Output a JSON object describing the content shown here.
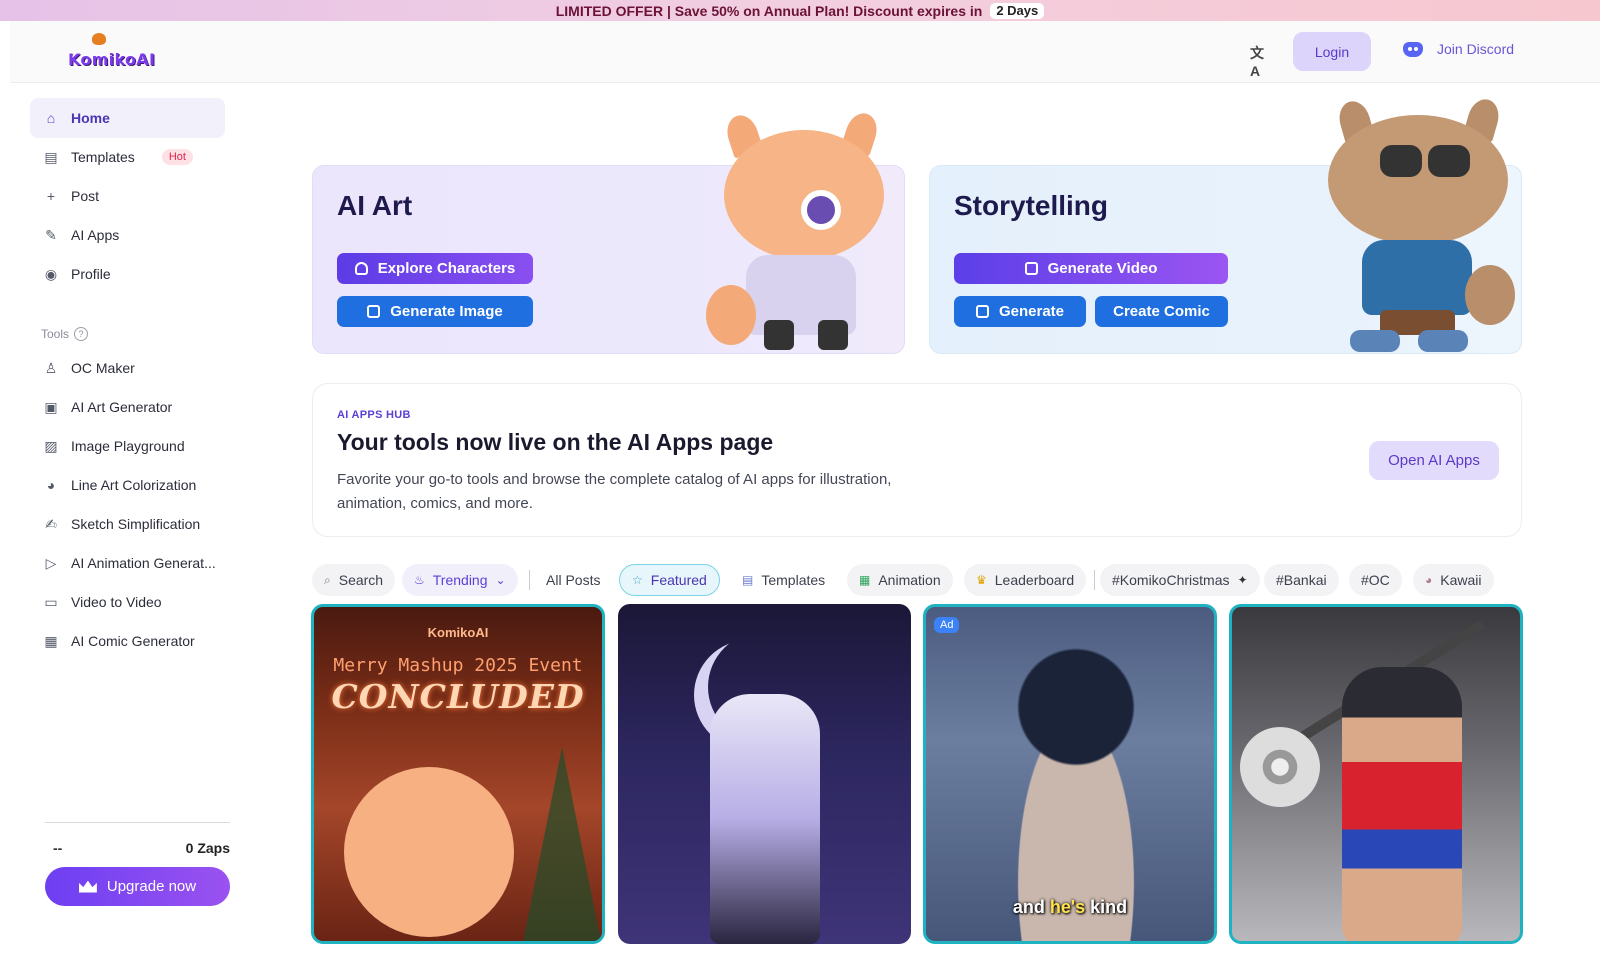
{
  "promo": {
    "text": "LIMITED OFFER | Save 50% on Annual Plan! Discount expires in",
    "days": "2 Days"
  },
  "header": {
    "logo": "KomikoAI",
    "login": "Login",
    "discord": "Join Discord"
  },
  "sidebar": {
    "items": [
      {
        "label": "Home",
        "icon": "home-icon"
      },
      {
        "label": "Templates",
        "icon": "templates-icon",
        "badge": "Hot"
      },
      {
        "label": "Post",
        "icon": "plus-icon"
      },
      {
        "label": "AI Apps",
        "icon": "magic-wand-icon"
      },
      {
        "label": "Profile",
        "icon": "profile-icon"
      }
    ],
    "tools_label": "Tools",
    "tools": [
      {
        "label": "OC Maker",
        "icon": "user-icon"
      },
      {
        "label": "AI Art Generator",
        "icon": "image-icon"
      },
      {
        "label": "Image Playground",
        "icon": "image-edit-icon"
      },
      {
        "label": "Line Art Colorization",
        "icon": "palette-icon"
      },
      {
        "label": "Sketch Simplification",
        "icon": "sketch-icon"
      },
      {
        "label": "AI Animation Generat...",
        "icon": "play-circle-icon"
      },
      {
        "label": "Video to Video",
        "icon": "video-icon"
      },
      {
        "label": "AI Comic Generator",
        "icon": "comic-grid-icon"
      }
    ],
    "user_name": "--",
    "zaps": "0 Zaps",
    "upgrade": "Upgrade now"
  },
  "hero": {
    "art": {
      "title": "AI Art",
      "buttons": [
        "Explore Characters",
        "Generate Image"
      ]
    },
    "story": {
      "title": "Storytelling",
      "buttons": [
        "Generate Video",
        "Generate",
        "Create Comic"
      ]
    }
  },
  "hub": {
    "eyebrow": "AI APPS HUB",
    "title": "Your tools now live on the AI Apps page",
    "desc": "Favorite your go-to tools and browse the complete catalog of AI apps for illustration, animation, comics, and more.",
    "button": "Open AI Apps"
  },
  "chips": [
    "Search",
    "Trending",
    "All Posts",
    "Featured",
    "Templates",
    "Animation",
    "Leaderboard",
    "#KomikoChristmas",
    "#Bankai",
    "#OC",
    "Kawaii"
  ],
  "cards": {
    "c1": {
      "brand": "KomikoAI",
      "event": "Merry Mashup 2025 Event",
      "status": "CONCLUDED"
    },
    "c3": {
      "ad": "Ad",
      "caption_a": "and ",
      "caption_b": "he's",
      "caption_c": " kind"
    }
  }
}
